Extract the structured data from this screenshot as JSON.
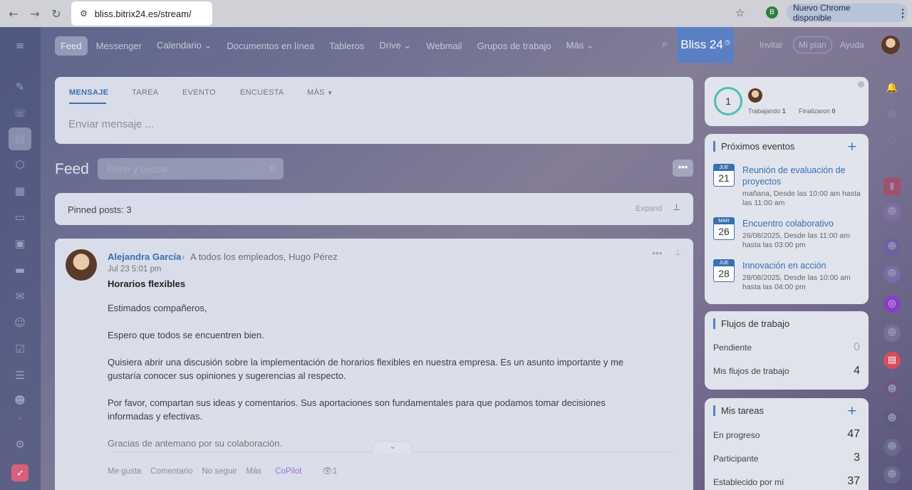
{
  "browser": {
    "url": "bliss.bitrix24.es/stream/",
    "profile_initial": "B",
    "update_label": "Nuevo Chrome disponible"
  },
  "topnav": {
    "items": [
      "Feed",
      "Messenger",
      "Calendario",
      "Documentos en línea",
      "Tableros",
      "Drive",
      "Webmail",
      "Grupos de trabajo",
      "Más"
    ],
    "brand": "Bliss 24",
    "invite": "Invitar",
    "my_plan": "Mi plan",
    "help": "Ayuda"
  },
  "composer": {
    "tabs": [
      "MENSAJE",
      "TAREA",
      "EVENTO",
      "ENCUESTA",
      "MÁS"
    ],
    "placeholder": "Enviar mensaje ..."
  },
  "feed": {
    "title": "Feed",
    "filter_placeholder": "Filtrar y buscar",
    "pinned_label": "Pinned posts:",
    "pinned_count": "3",
    "expand": "Expand"
  },
  "post": {
    "author": "Alejandra García",
    "recipients": "A todos los empleados, Hugo Pérez",
    "date": "Jul 23 5:01 pm",
    "title": "Horarios flexibles",
    "paragraphs": [
      "Estimados compañeros,",
      "Espero que todos se encuentren bien.",
      "Quisiera abrir una discusión sobre la implementación de horarios flexibles en nuestra empresa. Es un asunto importante y me gustaría conocer sus opiniones y sugerencias al respecto.",
      "Por favor, compartan sus ideas y comentarios. Sus aportaciones son fundamentales para que podamos tomar decisiones informadas y efectivas.",
      "Gracias de antemano por su colaboración."
    ],
    "actions": [
      "Me gusta",
      "Comentario",
      "No seguir",
      "Más",
      "CoPilot"
    ],
    "views": "1"
  },
  "worktime": {
    "count": "1",
    "working_label": "Trabajando",
    "working_count": "1",
    "finished_label": "Finalizaron",
    "finished_count": "0"
  },
  "events": {
    "title": "Próximos eventos",
    "items": [
      {
        "month": "JUE",
        "day": "21",
        "name": "Reunión de evaluación de proyectos",
        "time": "mañana, Desde las 10:00 am hasta las 11:00 am"
      },
      {
        "month": "MAR",
        "day": "26",
        "name": "Encuentro colaborativo",
        "time": "26/08/2025, Desde las 11:00 am hasta las 03:00 pm"
      },
      {
        "month": "JUE",
        "day": "28",
        "name": "Innovación en acción",
        "time": "28/08/2025, Desde las 10:00 am hasta las 04:00 pm"
      }
    ]
  },
  "workflows": {
    "title": "Flujos de trabajo",
    "rows": [
      {
        "label": "Pendiente",
        "value": "0"
      },
      {
        "label": "Mis flujos de trabajo",
        "value": "4"
      }
    ]
  },
  "tasks": {
    "title": "Mis tareas",
    "rows": [
      {
        "label": "En progreso",
        "value": "47"
      },
      {
        "label": "Participante",
        "value": "3"
      },
      {
        "label": "Establecido por mí",
        "value": "37"
      }
    ]
  }
}
